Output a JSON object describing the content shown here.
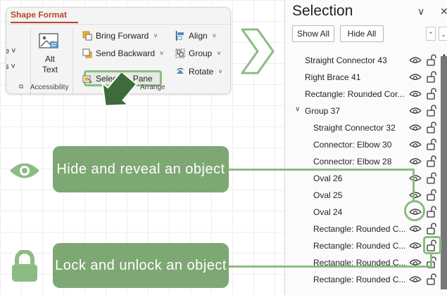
{
  "ribbon": {
    "tab_title": "Shape Format",
    "left_cut_1": "e ˅",
    "left_cut_2": "s ˅",
    "alt_text_line1": "Alt",
    "alt_text_line2": "Text",
    "accessibility_label": "Accessibility",
    "arrange_label": "Arrange",
    "bring_forward": "Bring Forward",
    "send_backward": "Send Backward",
    "selection_pane": "Selection Pane",
    "align": "Align",
    "group": "Group",
    "rotate": "Rotate"
  },
  "pane": {
    "title": "Selection",
    "show_all": "Show All",
    "hide_all": "Hide All",
    "items": [
      {
        "label": "Straight Connector 43",
        "indent": 0
      },
      {
        "label": "Right Brace 41",
        "indent": 0
      },
      {
        "label": "Rectangle: Rounded Cor...",
        "indent": 0
      },
      {
        "label": "Group 37",
        "indent": 0,
        "expanded": true
      },
      {
        "label": "Straight Connector 32",
        "indent": 1
      },
      {
        "label": "Connector: Elbow 30",
        "indent": 1
      },
      {
        "label": "Connector: Elbow 28",
        "indent": 1
      },
      {
        "label": "Oval 26",
        "indent": 1
      },
      {
        "label": "Oval 25",
        "indent": 1
      },
      {
        "label": "Oval 24",
        "indent": 1
      },
      {
        "label": "Rectangle: Rounded C...",
        "indent": 1
      },
      {
        "label": "Rectangle: Rounded C...",
        "indent": 1
      },
      {
        "label": "Rectangle: Rounded C...",
        "indent": 1
      },
      {
        "label": "Rectangle: Rounded C...",
        "indent": 1
      }
    ]
  },
  "callouts": {
    "hide_reveal": "Hide and reveal an object",
    "lock_unlock": "Lock and unlock an object"
  },
  "colors": {
    "accent_green": "#7ea873",
    "highlight_green": "#8dbb84",
    "tab_red": "#b7472a"
  },
  "icons": [
    "alt-text-icon",
    "bring-forward-icon",
    "send-backward-icon",
    "selection-pane-icon",
    "align-icon",
    "group-icon",
    "rotate-icon",
    "eye-icon",
    "lock-icon",
    "pointer-arrow-icon",
    "chevron-right-icon"
  ]
}
